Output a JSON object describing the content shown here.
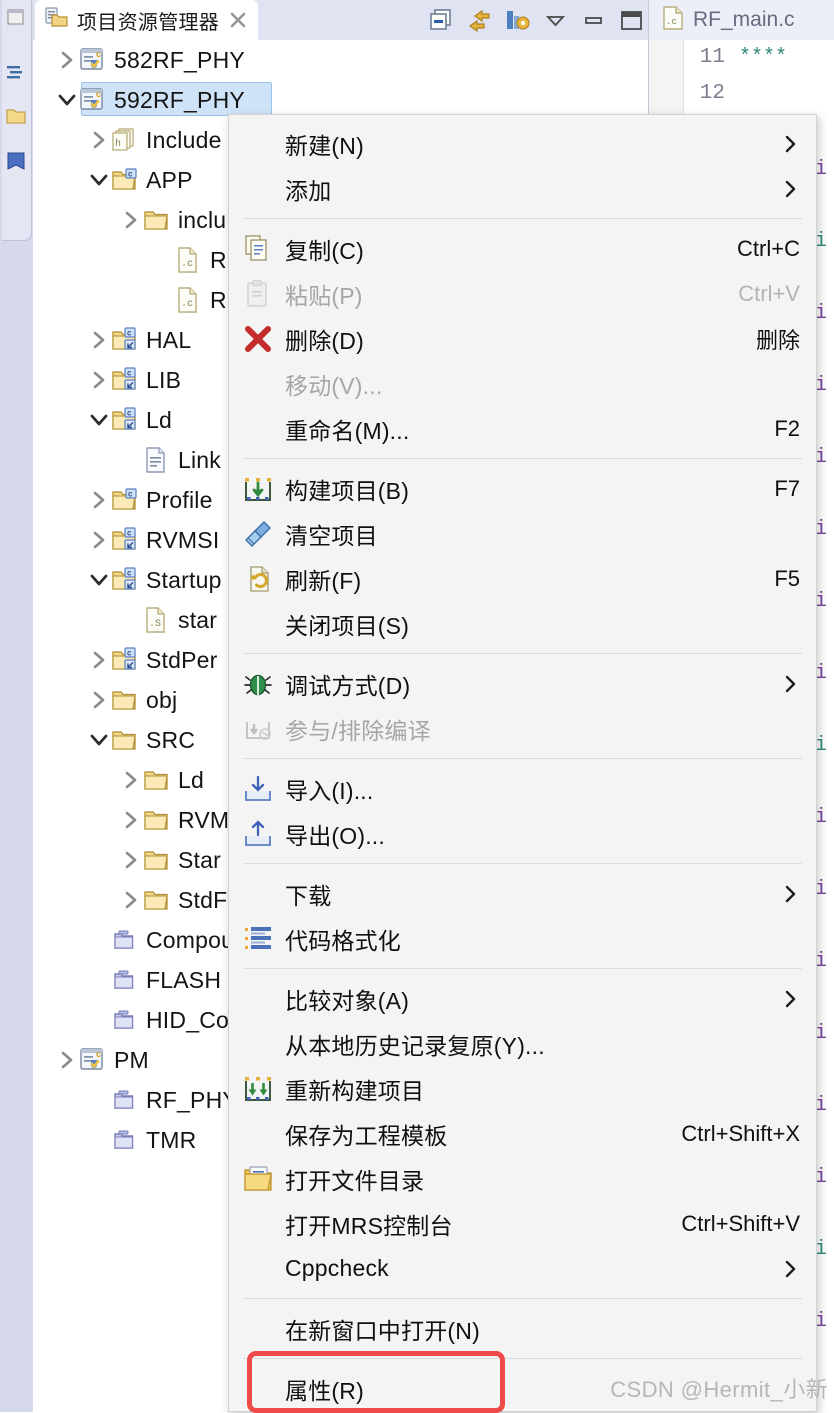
{
  "view": {
    "tab_title": "项目资源管理器",
    "close_icon": "close-icon",
    "toolbar": [
      {
        "name": "collapse-all-icon",
        "label": "折叠全部"
      },
      {
        "name": "link-with-editor-icon",
        "label": "链接到编辑器"
      },
      {
        "name": "view-menu-icon",
        "label": "视图菜单"
      },
      {
        "name": "view-dropdown-icon",
        "label": "下拉菜单"
      },
      {
        "name": "minimize-icon",
        "label": "最小化"
      },
      {
        "name": "maximize-icon",
        "label": "最大化"
      }
    ]
  },
  "tree": [
    {
      "label": "582RF_PHY",
      "indent": 0,
      "twisty": "collapsed",
      "icon": "c-project-icon",
      "selected": false
    },
    {
      "label": "592RF_PHY",
      "indent": 0,
      "twisty": "expanded",
      "icon": "c-project-icon",
      "selected": true
    },
    {
      "label": "Include",
      "indent": 1,
      "twisty": "collapsed",
      "icon": "includes-icon",
      "selected": false
    },
    {
      "label": "APP",
      "indent": 1,
      "twisty": "expanded",
      "icon": "source-folder-icon",
      "selected": false
    },
    {
      "label": "inclu",
      "indent": 2,
      "twisty": "collapsed",
      "icon": "folder-icon",
      "selected": false
    },
    {
      "label": "RF_r",
      "indent": 3,
      "twisty": "none",
      "icon": "c-file-icon",
      "selected": false
    },
    {
      "label": "RF_F",
      "indent": 3,
      "twisty": "none",
      "icon": "c-file-icon",
      "selected": false
    },
    {
      "label": "HAL",
      "indent": 1,
      "twisty": "collapsed",
      "icon": "linked-source-folder-icon",
      "selected": false
    },
    {
      "label": "LIB",
      "indent": 1,
      "twisty": "collapsed",
      "icon": "linked-source-folder-icon",
      "selected": false
    },
    {
      "label": "Ld",
      "indent": 1,
      "twisty": "expanded",
      "icon": "linked-source-folder-icon",
      "selected": false
    },
    {
      "label": "Link",
      "indent": 2,
      "twisty": "none",
      "icon": "ld-file-icon",
      "selected": false
    },
    {
      "label": "Profile",
      "indent": 1,
      "twisty": "collapsed",
      "icon": "source-folder-icon",
      "selected": false
    },
    {
      "label": "RVMSI",
      "indent": 1,
      "twisty": "collapsed",
      "icon": "linked-source-folder-icon",
      "selected": false
    },
    {
      "label": "Startup",
      "indent": 1,
      "twisty": "expanded",
      "icon": "linked-source-folder-icon",
      "selected": false
    },
    {
      "label": "star",
      "indent": 2,
      "twisty": "none",
      "icon": "asm-file-icon",
      "selected": false
    },
    {
      "label": "StdPer",
      "indent": 1,
      "twisty": "collapsed",
      "icon": "linked-source-folder-icon",
      "selected": false
    },
    {
      "label": "obj",
      "indent": 1,
      "twisty": "collapsed",
      "icon": "folder-icon",
      "selected": false
    },
    {
      "label": "SRC",
      "indent": 1,
      "twisty": "expanded",
      "icon": "folder-icon",
      "selected": false
    },
    {
      "label": "Ld",
      "indent": 2,
      "twisty": "collapsed",
      "icon": "folder-icon",
      "selected": false
    },
    {
      "label": "RVM",
      "indent": 2,
      "twisty": "collapsed",
      "icon": "folder-icon",
      "selected": false
    },
    {
      "label": "Star",
      "indent": 2,
      "twisty": "collapsed",
      "icon": "folder-icon",
      "selected": false
    },
    {
      "label": "StdF",
      "indent": 2,
      "twisty": "collapsed",
      "icon": "folder-icon",
      "selected": false
    },
    {
      "label": "Compour",
      "indent": 1,
      "twisty": "none",
      "icon": "closed-project-icon",
      "selected": false
    },
    {
      "label": "FLASH",
      "indent": 1,
      "twisty": "none",
      "icon": "closed-project-icon",
      "selected": false
    },
    {
      "label": "HID_Com",
      "indent": 1,
      "twisty": "none",
      "icon": "closed-project-icon",
      "selected": false
    },
    {
      "label": "PM",
      "indent": 0,
      "twisty": "collapsed",
      "icon": "c-project-icon",
      "selected": false
    },
    {
      "label": "RF_PHY_H",
      "indent": 1,
      "twisty": "none",
      "icon": "closed-project-icon",
      "selected": false
    },
    {
      "label": "TMR",
      "indent": 1,
      "twisty": "none",
      "icon": "closed-project-icon",
      "selected": false
    }
  ],
  "editor": {
    "tab_title": "RF_main.c",
    "tab_icon": "c-file-icon",
    "line_numbers": [
      "11",
      "12"
    ],
    "code_line": "****"
  },
  "context_menu": [
    {
      "type": "item",
      "label": "新建(N)",
      "icon": "",
      "accel": "",
      "submenu": true,
      "disabled": false
    },
    {
      "type": "item",
      "label": "添加",
      "icon": "",
      "accel": "",
      "submenu": true,
      "disabled": false
    },
    {
      "type": "separator"
    },
    {
      "type": "item",
      "label": "复制(C)",
      "icon": "copy-icon",
      "accel": "Ctrl+C",
      "submenu": false,
      "disabled": false
    },
    {
      "type": "item",
      "label": "粘贴(P)",
      "icon": "paste-icon",
      "accel": "Ctrl+V",
      "submenu": false,
      "disabled": true
    },
    {
      "type": "item",
      "label": "删除(D)",
      "icon": "delete-icon",
      "accel": "删除",
      "submenu": false,
      "disabled": false
    },
    {
      "type": "item",
      "label": "移动(V)...",
      "icon": "",
      "accel": "",
      "submenu": false,
      "disabled": true
    },
    {
      "type": "item",
      "label": "重命名(M)...",
      "icon": "",
      "accel": "F2",
      "submenu": false,
      "disabled": false
    },
    {
      "type": "separator"
    },
    {
      "type": "item",
      "label": "构建项目(B)",
      "icon": "build-icon",
      "accel": "F7",
      "submenu": false,
      "disabled": false
    },
    {
      "type": "item",
      "label": "清空项目",
      "icon": "clean-icon",
      "accel": "",
      "submenu": false,
      "disabled": false
    },
    {
      "type": "item",
      "label": "刷新(F)",
      "icon": "refresh-icon",
      "accel": "F5",
      "submenu": false,
      "disabled": false
    },
    {
      "type": "item",
      "label": "关闭项目(S)",
      "icon": "",
      "accel": "",
      "submenu": false,
      "disabled": false
    },
    {
      "type": "separator"
    },
    {
      "type": "item",
      "label": "调试方式(D)",
      "icon": "debug-icon",
      "accel": "",
      "submenu": true,
      "disabled": false
    },
    {
      "type": "item",
      "label": "参与/排除编译",
      "icon": "exclude-build-icon",
      "accel": "",
      "submenu": false,
      "disabled": true
    },
    {
      "type": "separator"
    },
    {
      "type": "item",
      "label": "导入(I)...",
      "icon": "import-icon",
      "accel": "",
      "submenu": false,
      "disabled": false
    },
    {
      "type": "item",
      "label": "导出(O)...",
      "icon": "export-icon",
      "accel": "",
      "submenu": false,
      "disabled": false
    },
    {
      "type": "separator"
    },
    {
      "type": "item",
      "label": "下载",
      "icon": "",
      "accel": "",
      "submenu": true,
      "disabled": false
    },
    {
      "type": "item",
      "label": "代码格式化",
      "icon": "format-icon",
      "accel": "",
      "submenu": false,
      "disabled": false
    },
    {
      "type": "separator"
    },
    {
      "type": "item",
      "label": "比较对象(A)",
      "icon": "",
      "accel": "",
      "submenu": true,
      "disabled": false
    },
    {
      "type": "item",
      "label": "从本地历史记录复原(Y)...",
      "icon": "",
      "accel": "",
      "submenu": false,
      "disabled": false
    },
    {
      "type": "item",
      "label": "重新构建项目",
      "icon": "rebuild-icon",
      "accel": "",
      "submenu": false,
      "disabled": false
    },
    {
      "type": "item",
      "label": "保存为工程模板",
      "icon": "",
      "accel": "Ctrl+Shift+X",
      "submenu": false,
      "disabled": false
    },
    {
      "type": "item",
      "label": "打开文件目录",
      "icon": "open-folder-icon",
      "accel": "",
      "submenu": false,
      "disabled": false
    },
    {
      "type": "item",
      "label": "打开MRS控制台",
      "icon": "",
      "accel": "Ctrl+Shift+V",
      "submenu": false,
      "disabled": false
    },
    {
      "type": "item",
      "label": "Cppcheck",
      "icon": "",
      "accel": "",
      "submenu": true,
      "disabled": false
    },
    {
      "type": "separator"
    },
    {
      "type": "item",
      "label": "在新窗口中打开(N)",
      "icon": "",
      "accel": "",
      "submenu": false,
      "disabled": false
    },
    {
      "type": "separator"
    },
    {
      "type": "item",
      "label": "属性(R)",
      "icon": "",
      "accel": "",
      "submenu": false,
      "disabled": false
    }
  ],
  "annotation": {
    "highlight_target": "属性(R)",
    "highlight_color": "#ef4a4a"
  },
  "watermark": "CSDN @Hermit_小新"
}
